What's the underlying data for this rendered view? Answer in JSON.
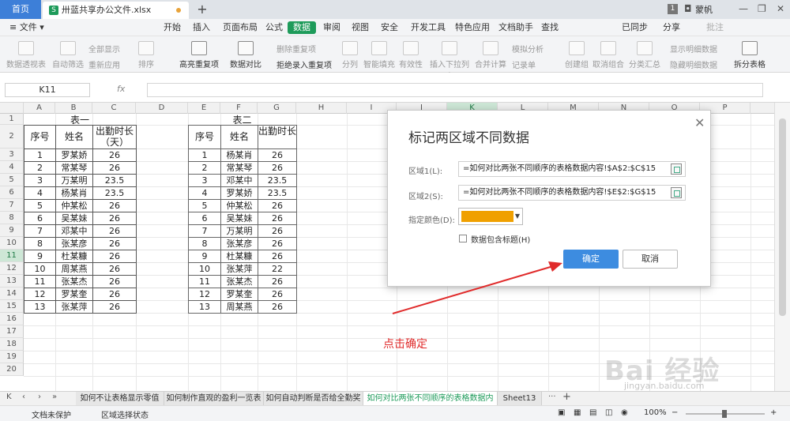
{
  "titlebar": {
    "home_tab": "首页",
    "doc_tab": "卅蓝共享办公文件.xlsx",
    "user": "蒙帆",
    "badge": "1"
  },
  "menubar": {
    "file": "≡ 文件 ▾",
    "items": [
      "开始",
      "插入",
      "页面布局",
      "公式",
      "数据",
      "审阅",
      "视图",
      "安全",
      "开发工具",
      "特色应用",
      "文档助手",
      "查找"
    ],
    "active": "数据",
    "right": [
      "已同步",
      "分享",
      "批注"
    ]
  },
  "ribbon": {
    "buttons": [
      "数据透视表",
      "自动筛选",
      "重新应用",
      "排序",
      "高亮重复项",
      "数据对比",
      "分列",
      "智能填充",
      "有效性",
      "插入下拉列表",
      "合并计算",
      "创建组",
      "取消组合",
      "分类汇总",
      "拆分表格"
    ],
    "small": [
      "全部显示",
      "删除重复项",
      "拒绝录入重复项",
      "模拟分析",
      "记录单",
      "显示明细数据",
      "隐藏明细数据"
    ]
  },
  "formula_bar": {
    "name_box": "K11",
    "fx": "fx"
  },
  "columns": [
    "A",
    "B",
    "C",
    "D",
    "E",
    "F",
    "G",
    "H",
    "I",
    "J",
    "K",
    "L",
    "M",
    "N",
    "O",
    "P"
  ],
  "rows": [
    "1",
    "2",
    "3",
    "4",
    "5",
    "6",
    "7",
    "8",
    "9",
    "10",
    "11",
    "12",
    "13",
    "14",
    "15",
    "16",
    "17",
    "18",
    "19",
    "20"
  ],
  "table1": {
    "caption": "表一",
    "headers": [
      "序号",
      "姓名",
      "出勤时长（天）"
    ],
    "rows": [
      [
        "1",
        "罗某娇",
        "26"
      ],
      [
        "2",
        "常某琴",
        "26"
      ],
      [
        "3",
        "万某明",
        "23.5"
      ],
      [
        "4",
        "杨某肖",
        "23.5"
      ],
      [
        "5",
        "仲某松",
        "26"
      ],
      [
        "6",
        "吴某妹",
        "26"
      ],
      [
        "7",
        "邓某中",
        "26"
      ],
      [
        "8",
        "张某彦",
        "26"
      ],
      [
        "9",
        "杜某糠",
        "26"
      ],
      [
        "10",
        "周某燕",
        "26"
      ],
      [
        "11",
        "张某杰",
        "26"
      ],
      [
        "12",
        "罗某奎",
        "26"
      ],
      [
        "13",
        "张某萍",
        "26"
      ]
    ]
  },
  "table2": {
    "caption": "表二",
    "headers": [
      "序号",
      "姓名",
      "出勤时长"
    ],
    "rows": [
      [
        "1",
        "杨某肖",
        "26"
      ],
      [
        "2",
        "常某琴",
        "26"
      ],
      [
        "3",
        "邓某中",
        "23.5"
      ],
      [
        "4",
        "罗某娇",
        "23.5"
      ],
      [
        "5",
        "仲某松",
        "26"
      ],
      [
        "6",
        "吴某妹",
        "26"
      ],
      [
        "7",
        "万某明",
        "26"
      ],
      [
        "8",
        "张某彦",
        "26"
      ],
      [
        "9",
        "杜某糠",
        "26"
      ],
      [
        "10",
        "张某萍",
        "22"
      ],
      [
        "11",
        "张某杰",
        "26"
      ],
      [
        "12",
        "罗某奎",
        "26"
      ],
      [
        "13",
        "周某燕",
        "26"
      ]
    ]
  },
  "dialog": {
    "title": "标记两区域不同数据",
    "range1_label": "区域1(L):",
    "range1_value": "=如何对比两张不同顺序的表格数据内容!$A$2:$C$15",
    "range2_label": "区域2(S):",
    "range2_value": "=如何对比两张不同顺序的表格数据内容!$E$2:$G$15",
    "color_label": "指定颜色(D):",
    "color": "#f0a000",
    "checkbox_label": "数据包含标题(H)",
    "ok": "确定",
    "cancel": "取消"
  },
  "annotation": "点击确定",
  "sheet_tabs": [
    "如何不让表格显示零值",
    "如何制作直观的盈利一览表",
    "如何自动判断是否给全勤奖",
    "如何对比两张不同顺序的表格数据内容",
    "Sheet13"
  ],
  "active_sheet": "如何对比两张不同顺序的表格数据内容",
  "statusbar": {
    "protect": "文档未保护",
    "mode": "区域选择状态",
    "zoom": "100%"
  },
  "watermark": {
    "main": "Bai 经验",
    "sub": "jingyan.baidu.com"
  }
}
